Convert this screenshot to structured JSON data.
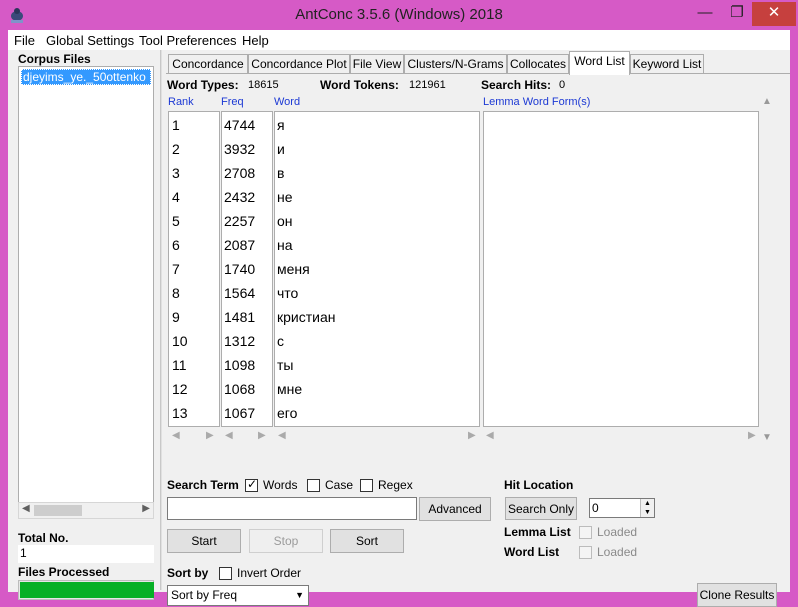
{
  "window": {
    "title": "AntConc 3.5.6 (Windows) 2018",
    "minimize_glyph": "—",
    "maximize_glyph": "❐",
    "close_glyph": "✕"
  },
  "menu": [
    "File",
    "Global Settings",
    "Tool Preferences",
    "Help"
  ],
  "left": {
    "corpus_files_label": "Corpus Files",
    "files": [
      "djeyims_ye._50ottenko"
    ],
    "total_label": "Total No.",
    "total_value": "1",
    "processed_label": "Files Processed",
    "progress": 1.0
  },
  "tabs": [
    {
      "label": "Concordance",
      "active": false
    },
    {
      "label": "Concordance Plot",
      "active": false
    },
    {
      "label": "File View",
      "active": false
    },
    {
      "label": "Clusters/N-Grams",
      "active": false
    },
    {
      "label": "Collocates",
      "active": false
    },
    {
      "label": "Word List",
      "active": true
    },
    {
      "label": "Keyword List",
      "active": false
    }
  ],
  "stats": {
    "types_label": "Word Types:",
    "types_value": "18615",
    "tokens_label": "Word Tokens:",
    "tokens_value": "121961",
    "hits_label": "Search Hits:",
    "hits_value": "0"
  },
  "columns": {
    "rank": "Rank",
    "freq": "Freq",
    "word": "Word",
    "lemma": "Lemma Word Form(s)"
  },
  "rows": [
    {
      "rank": "1",
      "freq": "4744",
      "word": "я"
    },
    {
      "rank": "2",
      "freq": "3932",
      "word": "и"
    },
    {
      "rank": "3",
      "freq": "2708",
      "word": "в"
    },
    {
      "rank": "4",
      "freq": "2432",
      "word": "не"
    },
    {
      "rank": "5",
      "freq": "2257",
      "word": "он"
    },
    {
      "rank": "6",
      "freq": "2087",
      "word": "на"
    },
    {
      "rank": "7",
      "freq": "1740",
      "word": "меня"
    },
    {
      "rank": "8",
      "freq": "1564",
      "word": "что"
    },
    {
      "rank": "9",
      "freq": "1481",
      "word": "кристиан"
    },
    {
      "rank": "10",
      "freq": "1312",
      "word": "с"
    },
    {
      "rank": "11",
      "freq": "1098",
      "word": "ты"
    },
    {
      "rank": "12",
      "freq": "1068",
      "word": "мне"
    },
    {
      "rank": "13",
      "freq": "1067",
      "word": "его"
    }
  ],
  "search": {
    "label": "Search Term",
    "words_label": "Words",
    "words_checked": true,
    "case_label": "Case",
    "case_checked": false,
    "regex_label": "Regex",
    "regex_checked": false,
    "term_value": "",
    "advanced_label": "Advanced"
  },
  "actions": {
    "start": "Start",
    "stop": "Stop",
    "sort": "Sort"
  },
  "sort": {
    "label": "Sort by",
    "invert_label": "Invert Order",
    "invert_checked": false,
    "selected": "Sort by Freq"
  },
  "hit_location": {
    "label": "Hit Location",
    "search_only_label": "Search Only",
    "spin_value": "0"
  },
  "lemma_list": {
    "label": "Lemma List",
    "loaded_label": "Loaded"
  },
  "word_list": {
    "label": "Word List",
    "loaded_label": "Loaded"
  },
  "clone_label": "Clone Results",
  "colors": {
    "titlebar": "#d65ac6",
    "selection": "#3399ff",
    "progress": "#06b025",
    "column_header": "#1c39d4",
    "close_button": "#c6403e"
  }
}
